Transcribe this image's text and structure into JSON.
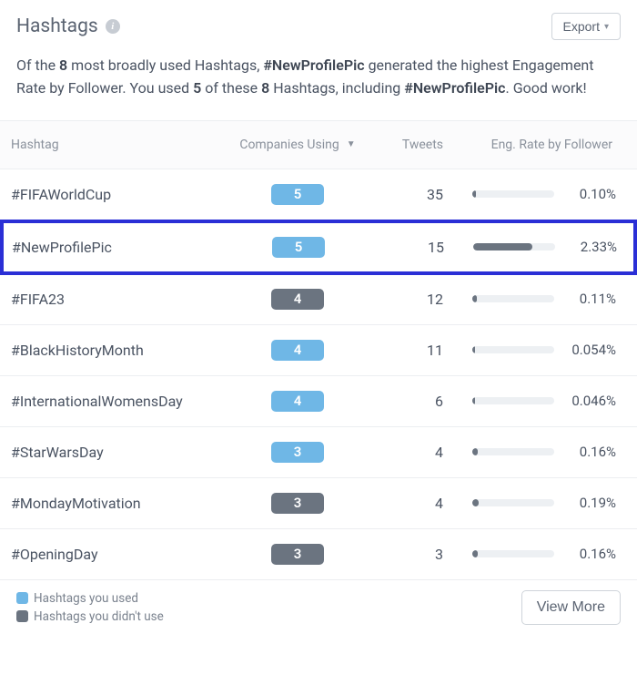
{
  "header": {
    "title": "Hashtags",
    "export_label": "Export"
  },
  "insight": {
    "prefix": "Of the ",
    "total_count": "8",
    "mid1": " most broadly used Hashtags, ",
    "top_hashtag": "#NewProfilePic",
    "mid2": " generated the highest Engagement Rate by Follower. You used ",
    "used_count": "5",
    "mid3": " of these ",
    "total_count2": "8",
    "mid4": " Hashtags, including ",
    "top_hashtag2": "#NewProfilePic",
    "suffix": ". Good work!"
  },
  "columns": {
    "hashtag": "Hashtag",
    "companies": "Companies Using",
    "tweets": "Tweets",
    "eng": "Eng. Rate by Follower"
  },
  "rows": [
    {
      "hashtag": "#FIFAWorldCup",
      "companies": "5",
      "used": true,
      "tweets": "35",
      "eng": "0.10%",
      "bar_pct": 4,
      "highlight": false
    },
    {
      "hashtag": "#NewProfilePic",
      "companies": "5",
      "used": true,
      "tweets": "15",
      "eng": "2.33%",
      "bar_pct": 72,
      "highlight": true
    },
    {
      "hashtag": "#FIFA23",
      "companies": "4",
      "used": false,
      "tweets": "12",
      "eng": "0.11%",
      "bar_pct": 5,
      "highlight": false
    },
    {
      "hashtag": "#BlackHistoryMonth",
      "companies": "4",
      "used": true,
      "tweets": "11",
      "eng": "0.054%",
      "bar_pct": 3,
      "highlight": false
    },
    {
      "hashtag": "#InternationalWomensDay",
      "companies": "4",
      "used": true,
      "tweets": "6",
      "eng": "0.046%",
      "bar_pct": 3,
      "highlight": false
    },
    {
      "hashtag": "#StarWarsDay",
      "companies": "3",
      "used": true,
      "tweets": "4",
      "eng": "0.16%",
      "bar_pct": 7,
      "highlight": false
    },
    {
      "hashtag": "#MondayMotivation",
      "companies": "3",
      "used": false,
      "tweets": "4",
      "eng": "0.19%",
      "bar_pct": 8,
      "highlight": false
    },
    {
      "hashtag": "#OpeningDay",
      "companies": "3",
      "used": false,
      "tweets": "3",
      "eng": "0.16%",
      "bar_pct": 7,
      "highlight": false
    }
  ],
  "legend": {
    "used": "Hashtags you used",
    "notused": "Hashtags you didn't use"
  },
  "footer": {
    "view_more": "View More"
  },
  "chart_data": {
    "type": "table",
    "title": "Hashtags — Engagement Rate by Follower",
    "columns": [
      "Hashtag",
      "Companies Using",
      "Used",
      "Tweets",
      "Eng. Rate by Follower (%)"
    ],
    "rows": [
      [
        "#FIFAWorldCup",
        5,
        true,
        35,
        0.1
      ],
      [
        "#NewProfilePic",
        5,
        true,
        15,
        2.33
      ],
      [
        "#FIFA23",
        4,
        false,
        12,
        0.11
      ],
      [
        "#BlackHistoryMonth",
        4,
        true,
        11,
        0.054
      ],
      [
        "#InternationalWomensDay",
        4,
        true,
        6,
        0.046
      ],
      [
        "#StarWarsDay",
        3,
        true,
        4,
        0.16
      ],
      [
        "#MondayMotivation",
        3,
        false,
        4,
        0.19
      ],
      [
        "#OpeningDay",
        3,
        false,
        3,
        0.16
      ]
    ]
  }
}
